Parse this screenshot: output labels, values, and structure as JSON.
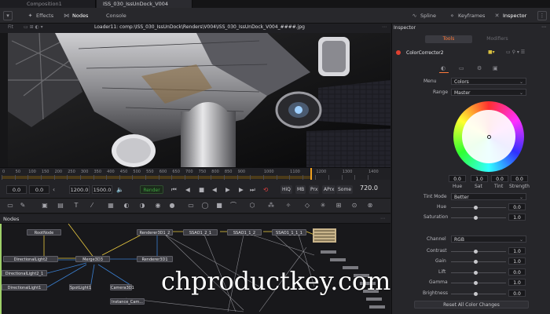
{
  "doc_tabs": [
    {
      "label": "Composition1",
      "active": false
    },
    {
      "label": "ISS_030_IssUnDock_V004",
      "active": true
    }
  ],
  "toolbar": {
    "effects_label": "Effects",
    "nodes_label": "Nodes",
    "console_label": "Console",
    "spline_label": "Spline",
    "keyframes_label": "Keyframes",
    "inspector_label": "Inspector"
  },
  "viewer": {
    "fit_label": "Fit",
    "title": "Loader11: comp:\\ISS_030_IssUnDock\\Renders\\V004\\ISS_030_IssUnDock_V004_####.jpg"
  },
  "ruler": {
    "ticks": [
      "0",
      "50",
      "100",
      "150",
      "200",
      "250",
      "300",
      "350",
      "400",
      "450",
      "500",
      "550",
      "600",
      "650",
      "700",
      "750",
      "800",
      "850",
      "900",
      "950",
      "1000",
      "1050",
      "1100",
      "1150",
      "1200",
      "1250",
      "1300",
      "1350",
      "1400"
    ],
    "visible_labels": [
      "0",
      "50",
      "100",
      "150",
      "200",
      "250",
      "300",
      "350",
      "400",
      "450",
      "500",
      "550",
      "600",
      "650",
      "700",
      "750",
      "800",
      "850",
      "900",
      "1000",
      "1100",
      "1200",
      "1300",
      "1400"
    ]
  },
  "transport": {
    "start": "0.0",
    "start2": "0.0",
    "end": "1200.0",
    "end2": "1500.0",
    "render_label": "Render",
    "hiq": "HiQ",
    "mb": "MB",
    "prx": "Prx",
    "aprx": "APrx",
    "some": "Some",
    "current_frame": "720.0"
  },
  "nodes_panel": {
    "title": "Nodes",
    "nodes": [
      {
        "label": "RootNode"
      },
      {
        "label": "Renderer3D1_2"
      },
      {
        "label": "SSAO1_2_1"
      },
      {
        "label": "SSAO1_1_2"
      },
      {
        "label": "SSAO1_1_1_1"
      },
      {
        "label": "DirectionalLight2"
      },
      {
        "label": "Merge3D3"
      },
      {
        "label": "Renderer3D1"
      },
      {
        "label": "DirectionalLight2_1"
      },
      {
        "label": "DirectionalLight1"
      },
      {
        "label": "SpotLight1"
      },
      {
        "label": "Camera3D1"
      },
      {
        "label": "Instance_Cam..."
      }
    ]
  },
  "inspector": {
    "title": "Inspector",
    "tabs": [
      "Tools",
      "Modifiers"
    ],
    "tool_name": "ColorCorrector2",
    "menu_label": "Menu",
    "menu_value": "Colors",
    "range_label": "Range",
    "range_value": "Master",
    "wheel_values": [
      "0.0",
      "1.0",
      "0.0",
      "0.0"
    ],
    "wheel_labels": [
      "Hue",
      "Sat",
      "Tint",
      "Strength"
    ],
    "tint_mode_label": "Tint Mode",
    "tint_mode_value": "Better",
    "hue_label": "Hue",
    "hue_value": "0.0",
    "saturation_label": "Saturation",
    "saturation_value": "1.0",
    "channel_label": "Channel",
    "channel_value": "RGB",
    "contrast_label": "Contrast",
    "contrast_value": "1.0",
    "gain_label": "Gain",
    "gain_value": "1.0",
    "lift_label": "Lift",
    "lift_value": "0.0",
    "gamma_label": "Gamma",
    "gamma_value": "1.0",
    "brightness_label": "Brightness",
    "brightness_value": "0.0",
    "reset_label": "Reset All Color Changes"
  },
  "watermark": "chproductkey.com",
  "colors": {
    "accent_orange": "#f0a020",
    "render_green": "#3fa63f",
    "node_yellow_link": "#e8c840",
    "node_blue_link": "#3a7fd0"
  }
}
